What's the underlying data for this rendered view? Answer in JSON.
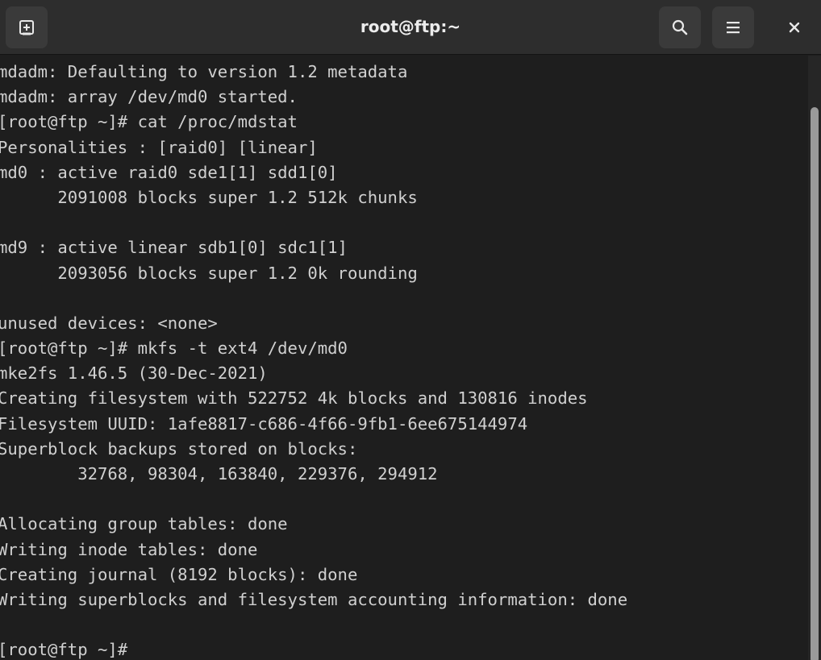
{
  "window": {
    "title": "root@ftp:~"
  },
  "headerbar": {
    "new_tab_icon": "new-tab-icon",
    "search_icon": "search-icon",
    "menu_icon": "hamburger-menu-icon",
    "close_icon": "close-icon"
  },
  "terminal": {
    "lines": [
      "mdadm: Defaulting to version 1.2 metadata",
      "mdadm: array /dev/md0 started.",
      "[root@ftp ~]# cat /proc/mdstat",
      "Personalities : [raid0] [linear]",
      "md0 : active raid0 sde1[1] sdd1[0]",
      "      2091008 blocks super 1.2 512k chunks",
      "",
      "md9 : active linear sdb1[0] sdc1[1]",
      "      2093056 blocks super 1.2 0k rounding",
      "",
      "unused devices: <none>",
      "[root@ftp ~]# mkfs -t ext4 /dev/md0",
      "mke2fs 1.46.5 (30-Dec-2021)",
      "Creating filesystem with 522752 4k blocks and 130816 inodes",
      "Filesystem UUID: 1afe8817-c686-4f66-9fb1-6ee675144974",
      "Superblock backups stored on blocks:",
      "        32768, 98304, 163840, 229376, 294912",
      "",
      "Allocating group tables: done",
      "Writing inode tables: done",
      "Creating journal (8192 blocks): done",
      "Writing superblocks and filesystem accounting information: done",
      "",
      "[root@ftp ~]#"
    ]
  },
  "colors": {
    "background": "#1e1e1e",
    "headerbar": "#2d2d2d",
    "text": "#d0d0d0"
  }
}
